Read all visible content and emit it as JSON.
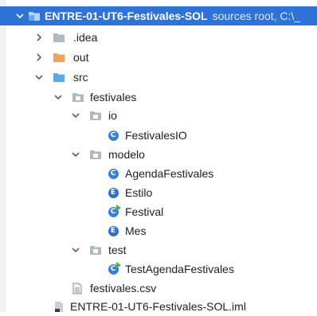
{
  "project_tree": {
    "root": {
      "label": "ENTRE-01-UT6-Festivales-SOL",
      "subtext": "sources root,  C:\\_",
      "icon": "module-folder-icon"
    },
    "items": [
      {
        "label": ".idea",
        "icon": "folder-icon",
        "expanded": false
      },
      {
        "label": "out",
        "icon": "excluded-folder-icon",
        "expanded": false
      },
      {
        "label": "src",
        "icon": "source-folder-icon",
        "expanded": true
      },
      {
        "label": "festivales",
        "icon": "package-icon",
        "expanded": true
      },
      {
        "label": "io",
        "icon": "package-icon",
        "expanded": true
      },
      {
        "label": "FestivalesIO",
        "icon": "class-icon",
        "badge": "C"
      },
      {
        "label": "modelo",
        "icon": "package-icon",
        "expanded": true
      },
      {
        "label": "AgendaFestivales",
        "icon": "class-icon",
        "badge": "C"
      },
      {
        "label": "Estilo",
        "icon": "enum-icon",
        "badge": "E"
      },
      {
        "label": "Festival",
        "icon": "runnable-class-icon",
        "badge": "C"
      },
      {
        "label": "Mes",
        "icon": "enum-icon",
        "badge": "E"
      },
      {
        "label": "test",
        "icon": "package-icon",
        "expanded": true
      },
      {
        "label": "TestAgendaFestivales",
        "icon": "runnable-class-icon",
        "badge": "C"
      },
      {
        "label": "festivales.csv",
        "icon": "text-file-icon"
      },
      {
        "label": "ENTRE-01-UT6-Festivales-SOL.iml",
        "icon": "iml-file-icon"
      }
    ]
  },
  "colors": {
    "selection": "#2f73d6",
    "folder": "#aeb9c0",
    "excluded_folder": "#f2a35e",
    "source_folder": "#5ca7e6",
    "class_badge": "#3a7fd9",
    "run_marker": "#4caf50"
  }
}
